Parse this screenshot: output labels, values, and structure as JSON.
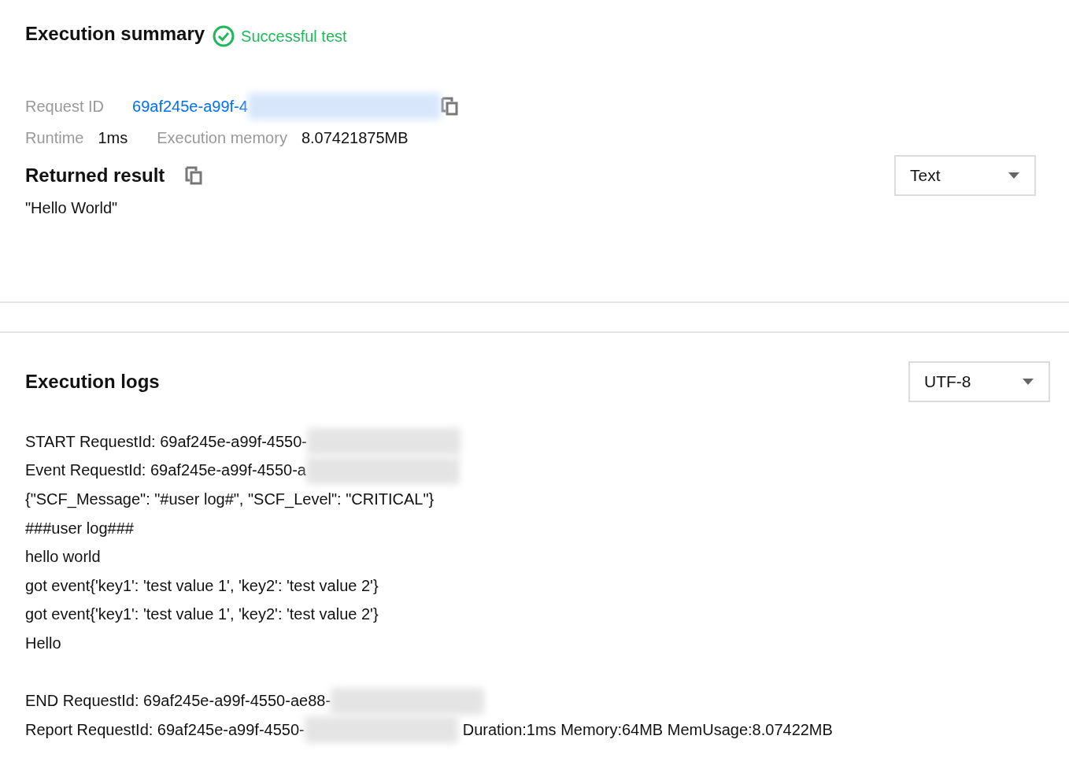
{
  "summary": {
    "title": "Execution summary",
    "status": {
      "label": "Successful test",
      "kind": "success"
    },
    "request_id": {
      "label": "Request ID",
      "value": "69af245e-a99f-4",
      "redacted": true
    },
    "runtime": {
      "label": "Runtime",
      "value": "1ms"
    },
    "memory": {
      "label": "Execution memory",
      "value": "8.07421875MB"
    }
  },
  "result": {
    "title": "Returned result",
    "value": "\"Hello World\"",
    "format": "Text"
  },
  "logs": {
    "title": "Execution logs",
    "encoding": "UTF-8",
    "lines": [
      {
        "kind": "text",
        "text": "START RequestId: 69af245e-a99f-4550-",
        "redacted": true
      },
      {
        "kind": "text",
        "text": "Event RequestId: 69af245e-a99f-4550-a",
        "redacted": true
      },
      {
        "kind": "text",
        "text": "{\"SCF_Message\": \"#user log#\", \"SCF_Level\": \"CRITICAL\"}",
        "redacted": false
      },
      {
        "kind": "text",
        "text": "###user log###",
        "redacted": false
      },
      {
        "kind": "text",
        "text": "hello world",
        "redacted": false
      },
      {
        "kind": "text",
        "text": "got event{'key1': 'test value 1', 'key2': 'test value 2'}",
        "redacted": false
      },
      {
        "kind": "text",
        "text": "got event{'key1': 'test value 1', 'key2': 'test value 2'}",
        "redacted": false
      },
      {
        "kind": "text",
        "text": "Hello",
        "redacted": false
      },
      {
        "kind": "gap"
      },
      {
        "kind": "text",
        "text": "END RequestId: 69af245e-a99f-4550-ae88-",
        "redacted": true
      },
      {
        "kind": "text",
        "text": "Report RequestId: 69af245e-a99f-4550-",
        "redacted": true,
        "suffix": "Duration:1ms Memory:64MB MemUsage:8.07422MB"
      }
    ]
  }
}
